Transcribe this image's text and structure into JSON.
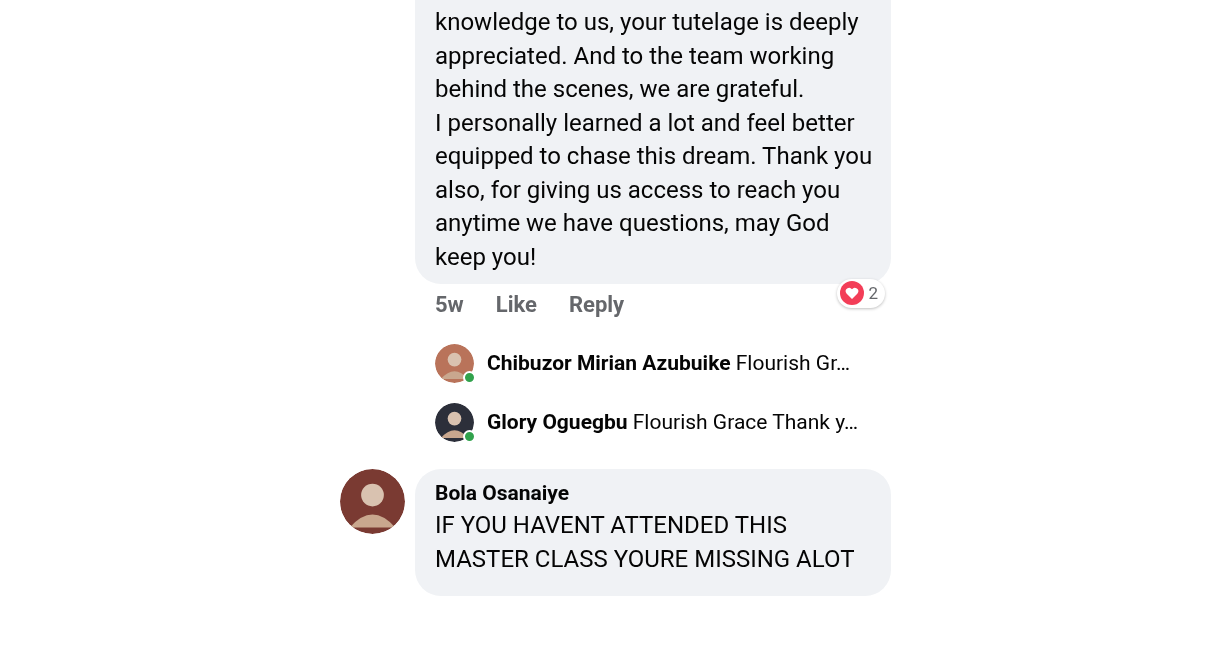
{
  "thread": {
    "text": "knowledge to us, your tutelage is deeply appreciated. And to the team working behind the scenes, we are grateful.\nI personally learned a lot and feel better equipped to chase this dream. Thank you also, for giving us access to reach you anytime we have questions, may God keep you!",
    "time": "5w",
    "actions": [
      "Like",
      "Reply"
    ],
    "reaction_count": "2",
    "replies": [
      {
        "author": "Chibuzor Mirian Azubuike",
        "preview": "Flourish Gr…",
        "online": true
      },
      {
        "author": "Glory Oguegbu",
        "preview": "Flourish Grace Thank y…",
        "online": true
      }
    ]
  },
  "comment": {
    "author": "Bola Osanaiye",
    "text": "IF YOU HAVENT ATTENDED THIS MASTER CLASS YOURE MISSING ALOT"
  }
}
